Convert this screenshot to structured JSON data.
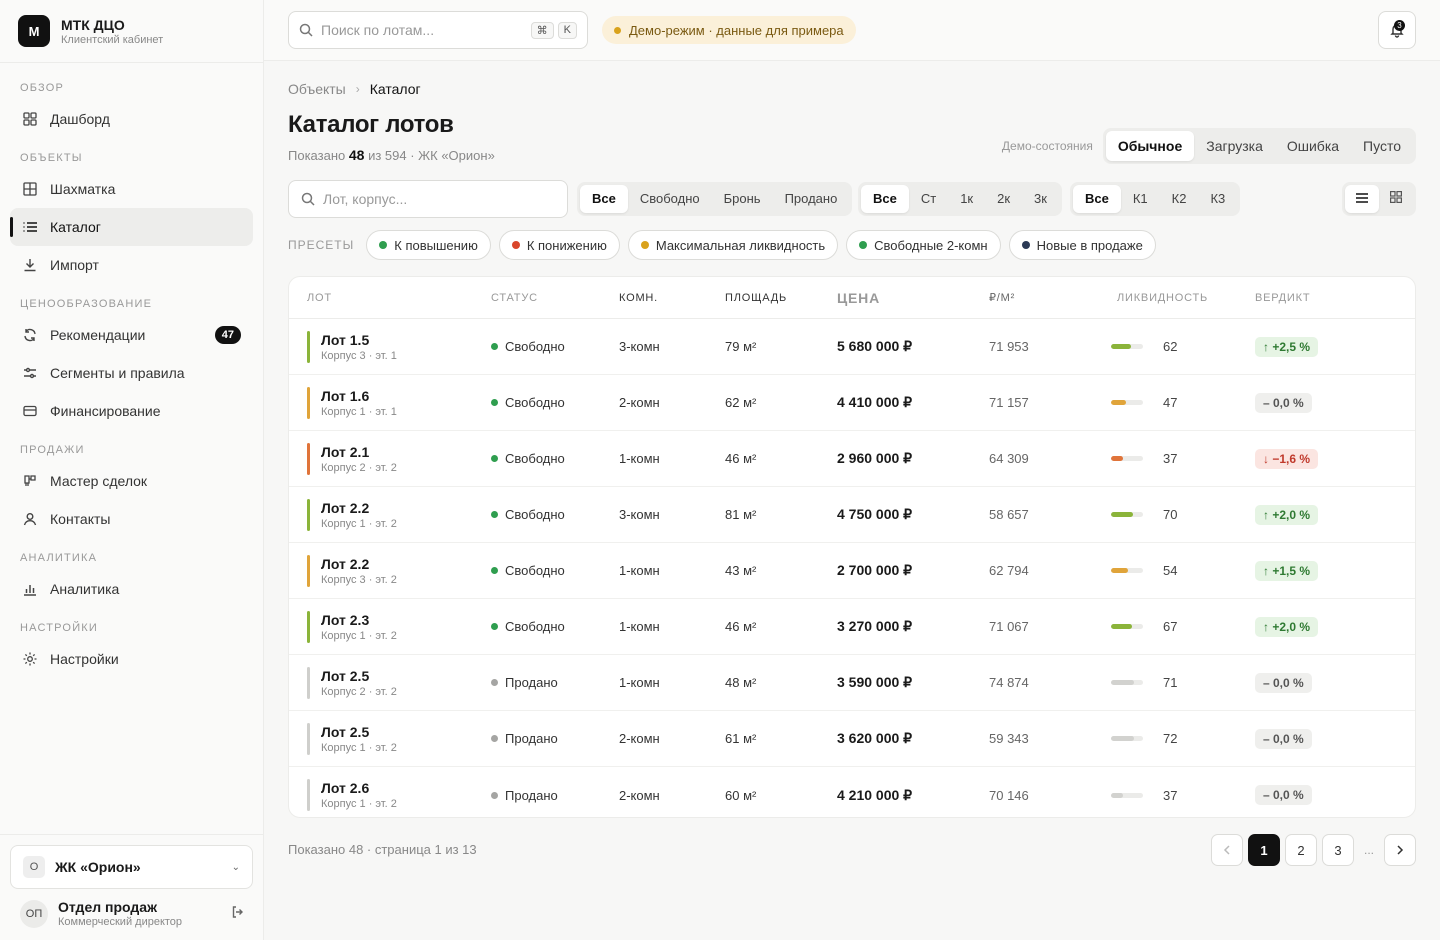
{
  "brand": {
    "logo": "М",
    "name": "МТК ДЦО",
    "subtitle": "Клиентский кабинет"
  },
  "nav": {
    "sections": [
      {
        "title": "ОБЗОР",
        "items": [
          {
            "label": "Дашборд",
            "icon": "grid-icon"
          }
        ]
      },
      {
        "title": "ОБЪЕКТЫ",
        "items": [
          {
            "label": "Шахматка",
            "icon": "chess-grid-icon"
          },
          {
            "label": "Каталог",
            "icon": "list-icon",
            "active": true
          },
          {
            "label": "Импорт",
            "icon": "download-icon"
          }
        ]
      },
      {
        "title": "ЦЕНООБРАЗОВАНИЕ",
        "items": [
          {
            "label": "Рекомендации",
            "icon": "refresh-icon",
            "badge": "47"
          },
          {
            "label": "Сегменты и правила",
            "icon": "sliders-icon"
          },
          {
            "label": "Финансирование",
            "icon": "card-icon"
          }
        ]
      },
      {
        "title": "ПРОДАЖИ",
        "items": [
          {
            "label": "Мастер сделок",
            "icon": "handshake-icon"
          },
          {
            "label": "Контакты",
            "icon": "user-icon"
          }
        ]
      },
      {
        "title": "АНАЛИТИКА",
        "items": [
          {
            "label": "Аналитика",
            "icon": "bar-chart-icon"
          }
        ]
      },
      {
        "title": "НАСТРОЙКИ",
        "items": [
          {
            "label": "Настройки",
            "icon": "sun-gear-icon"
          }
        ]
      }
    ]
  },
  "project": {
    "initial": "О",
    "name": "ЖК «Орион»"
  },
  "user": {
    "initials": "ОП",
    "name": "Отдел продаж",
    "role": "Коммерческий директор"
  },
  "topbar": {
    "search_placeholder": "Поиск по лотам...",
    "kbd": [
      "⌘",
      "K"
    ],
    "demo_label": "Демо-режим · данные для примера",
    "notifications": "3"
  },
  "breadcrumb": {
    "parent": "Объекты",
    "current": "Каталог"
  },
  "page": {
    "title": "Каталог лотов",
    "sub_prefix": "Показано",
    "sub_count": "48",
    "sub_suffix": "из 594 · ЖК «Орион»"
  },
  "demo_states": {
    "label": "Демо-состояния",
    "options": [
      "Обычное",
      "Загрузка",
      "Ошибка",
      "Пусто"
    ],
    "selected": 0
  },
  "filters": {
    "search_placeholder": "Лот, корпус...",
    "status": {
      "options": [
        "Все",
        "Свободно",
        "Бронь",
        "Продано"
      ],
      "selected": 0
    },
    "rooms": {
      "options": [
        "Все",
        "Ст",
        "1к",
        "2к",
        "3к"
      ],
      "selected": 0
    },
    "building": {
      "options": [
        "Все",
        "К1",
        "К2",
        "К3"
      ],
      "selected": 0
    },
    "view": {
      "selected": "list"
    }
  },
  "presets": {
    "label": "ПРЕСЕТЫ",
    "items": [
      {
        "label": "К повышению",
        "color": "#2f9e4f"
      },
      {
        "label": "К понижению",
        "color": "#d9462b"
      },
      {
        "label": "Максимальная ликвидность",
        "color": "#d9a21c"
      },
      {
        "label": "Свободные 2-комн",
        "color": "#2f9e4f"
      },
      {
        "label": "Новые в продаже",
        "color": "#2b3a55"
      }
    ]
  },
  "table": {
    "headers": [
      "ЛОТ",
      "СТАТУС",
      "КОМН.",
      "ПЛОЩАДЬ",
      "ЦЕНА",
      "₽/М²",
      "ЛИКВИДНОСТЬ",
      "ВЕРДИКТ"
    ],
    "rows": [
      {
        "lot": "Лот 1.5",
        "sub": "Корпус 3 · эт. 1",
        "status": "Свободно",
        "rooms": "3-комн",
        "area": "79 м²",
        "price": "5 680 000 ₽",
        "ppm": "71 953",
        "liq": 62,
        "verdict": "↑ +2,5 %",
        "trend": "up"
      },
      {
        "lot": "Лот 1.6",
        "sub": "Корпус 1 · эт. 1",
        "status": "Свободно",
        "rooms": "2-комн",
        "area": "62 м²",
        "price": "4 410 000 ₽",
        "ppm": "71 157",
        "liq": 47,
        "verdict": "– 0,0 %",
        "trend": "flat"
      },
      {
        "lot": "Лот 2.1",
        "sub": "Корпус 2 · эт. 2",
        "status": "Свободно",
        "rooms": "1-комн",
        "area": "46 м²",
        "price": "2 960 000 ₽",
        "ppm": "64 309",
        "liq": 37,
        "verdict": "↓ −1,6 %",
        "trend": "down"
      },
      {
        "lot": "Лот 2.2",
        "sub": "Корпус 1 · эт. 2",
        "status": "Свободно",
        "rooms": "3-комн",
        "area": "81 м²",
        "price": "4 750 000 ₽",
        "ppm": "58 657",
        "liq": 70,
        "verdict": "↑ +2,0 %",
        "trend": "up"
      },
      {
        "lot": "Лот 2.2",
        "sub": "Корпус 3 · эт. 2",
        "status": "Свободно",
        "rooms": "1-комн",
        "area": "43 м²",
        "price": "2 700 000 ₽",
        "ppm": "62 794",
        "liq": 54,
        "verdict": "↑ +1,5 %",
        "trend": "up"
      },
      {
        "lot": "Лот 2.3",
        "sub": "Корпус 1 · эт. 2",
        "status": "Свободно",
        "rooms": "1-комн",
        "area": "46 м²",
        "price": "3 270 000 ₽",
        "ppm": "71 067",
        "liq": 67,
        "verdict": "↑ +2,0 %",
        "trend": "up"
      },
      {
        "lot": "Лот 2.5",
        "sub": "Корпус 2 · эт. 2",
        "status": "Продано",
        "rooms": "1-комн",
        "area": "48 м²",
        "price": "3 590 000 ₽",
        "ppm": "74 874",
        "liq": 71,
        "verdict": "– 0,0 %",
        "trend": "flat"
      },
      {
        "lot": "Лот 2.5",
        "sub": "Корпус 1 · эт. 2",
        "status": "Продано",
        "rooms": "2-комн",
        "area": "61 м²",
        "price": "3 620 000 ₽",
        "ppm": "59 343",
        "liq": 72,
        "verdict": "– 0,0 %",
        "trend": "flat"
      },
      {
        "lot": "Лот 2.6",
        "sub": "Корпус 1 · эт. 2",
        "status": "Продано",
        "rooms": "2-комн",
        "area": "60 м²",
        "price": "4 210 000 ₽",
        "ppm": "70 146",
        "liq": 37,
        "verdict": "– 0,0 %",
        "trend": "flat"
      }
    ]
  },
  "footer": {
    "info": "Показано 48 · страница 1 из 13",
    "pages": [
      "1",
      "2",
      "3"
    ],
    "current": "1",
    "ellipsis": "..."
  },
  "colors": {
    "accent": "#111111",
    "free": "#2f9e4f",
    "sold": "#a5a5a3",
    "liq_high": "#8bb43a",
    "liq_mid": "#e0a43a",
    "liq_low": "#e0743a",
    "up_bg": "#e6f4e4",
    "up_fg": "#2f7a32",
    "down_bg": "#fbe5e1",
    "down_fg": "#c0392b",
    "flat_bg": "#efefed",
    "flat_fg": "#555555"
  }
}
